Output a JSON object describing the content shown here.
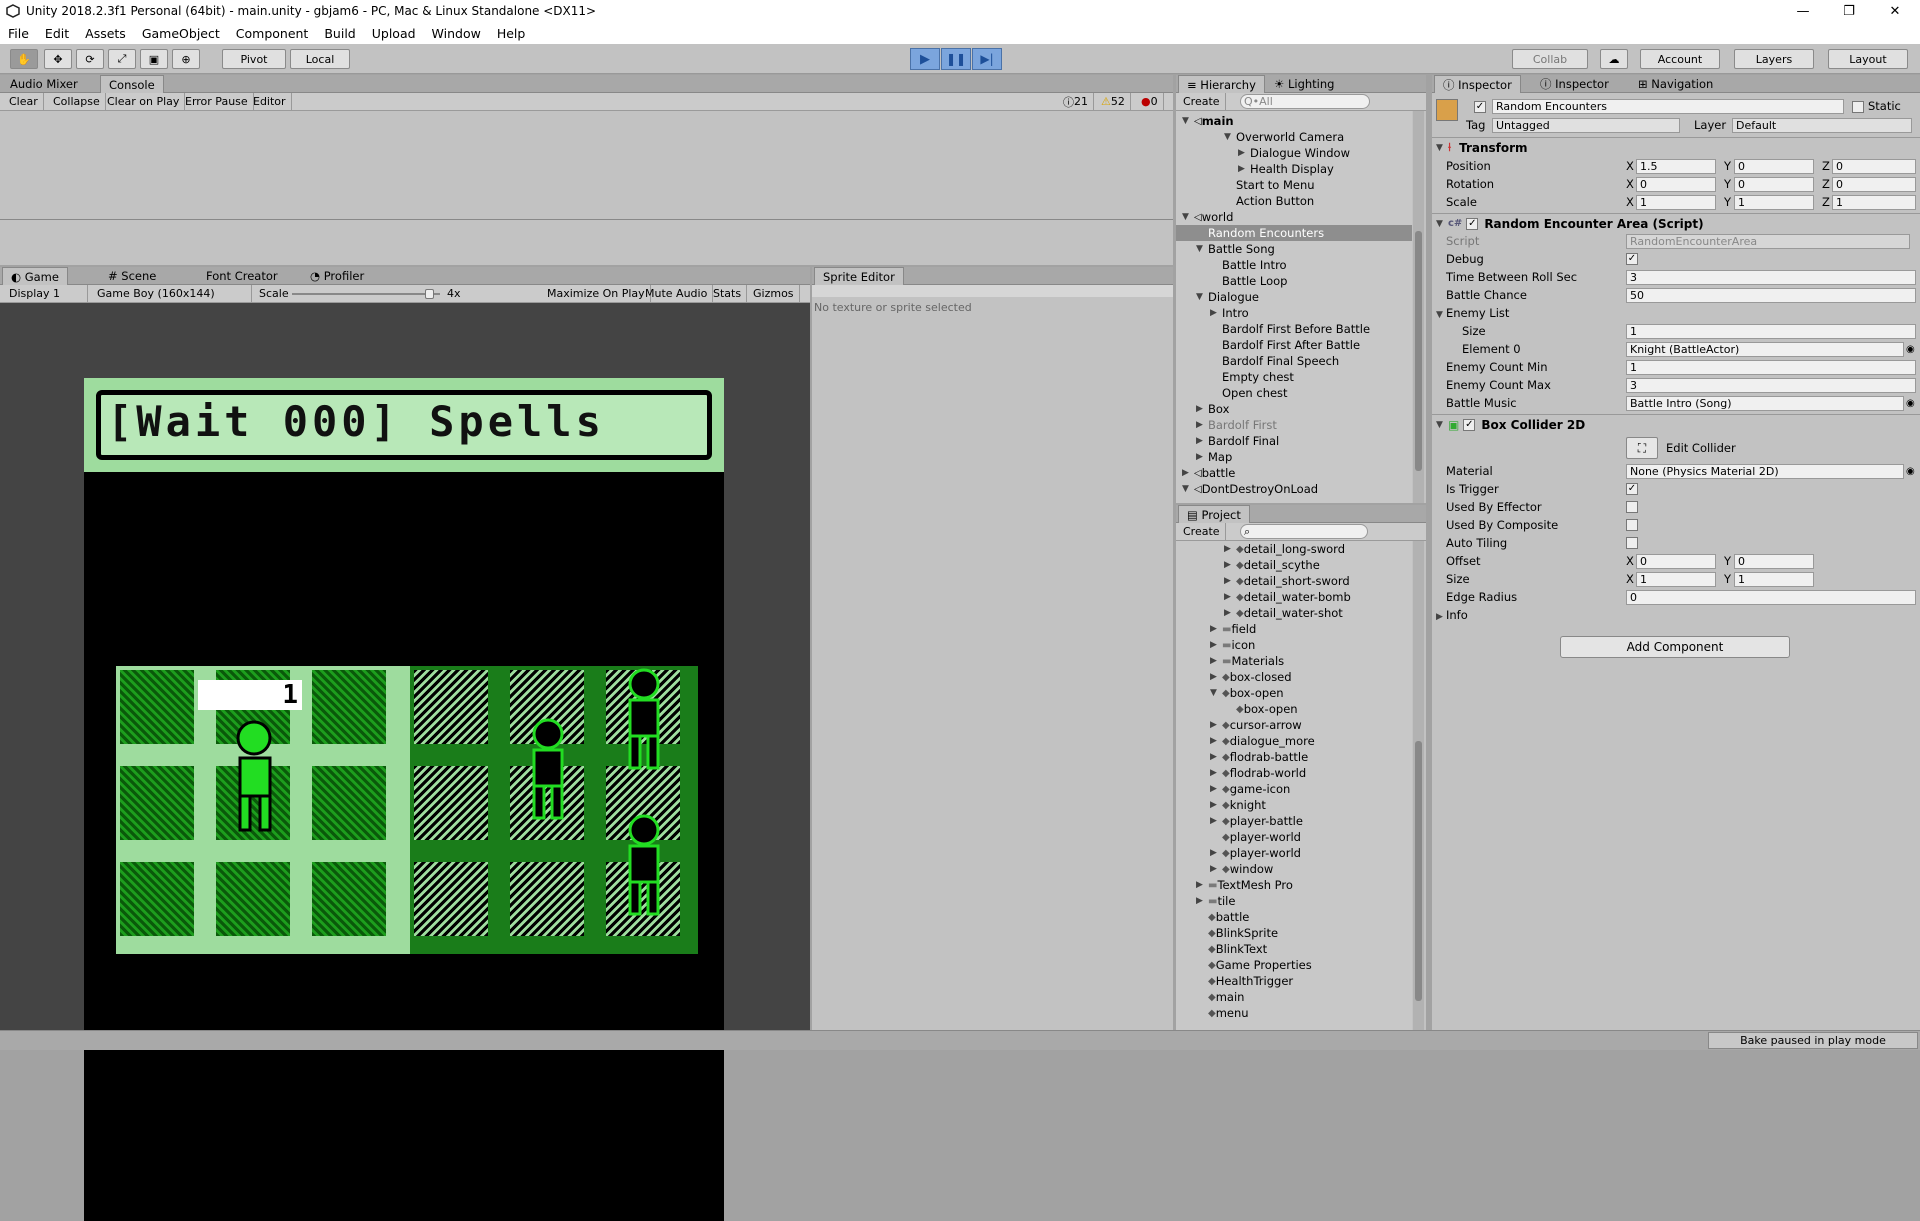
{
  "window": {
    "title": "Unity 2018.2.3f1 Personal (64bit) - main.unity - gbjam6 - PC, Mac & Linux Standalone <DX11>"
  },
  "menu": [
    "File",
    "Edit",
    "Assets",
    "GameObject",
    "Component",
    "Build",
    "Upload",
    "Window",
    "Help"
  ],
  "toolbar": {
    "pivot": "Pivot",
    "local": "Local",
    "collab": "Collab",
    "account": "Account",
    "layers": "Layers",
    "layout": "Layout"
  },
  "console": {
    "tabs": [
      "Audio Mixer",
      "Console"
    ],
    "buttons": [
      "Clear",
      "Collapse",
      "Clear on Play",
      "Error Pause",
      "Editor"
    ],
    "counts": {
      "info": "21",
      "warn": "52",
      "error": "0"
    }
  },
  "game": {
    "tabs": [
      "Game",
      "Scene",
      "Font Creator",
      "Profiler"
    ],
    "display": "Display 1",
    "resolution": "Game Boy (160x144)",
    "scale_label": "Scale",
    "scale_value": "4x",
    "scale_fraction": 0.95,
    "buttons": [
      "Maximize On Play",
      "Mute Audio",
      "Stats",
      "Gizmos"
    ],
    "banner": "[Wait 000] Spells",
    "counter": "1"
  },
  "sprite_editor": {
    "tab": "Sprite Editor",
    "message": "No texture or sprite selected"
  },
  "hierarchy": {
    "tabs": [
      "Hierarchy",
      "Lighting"
    ],
    "create": "Create",
    "search_placeholder": "Q•All",
    "rows": [
      {
        "label": "main",
        "indent": 0,
        "tri": "down",
        "bold": true
      },
      {
        "label": "Overworld Camera",
        "indent": 3,
        "tri": "down"
      },
      {
        "label": "Dialogue Window",
        "indent": 4,
        "tri": "right"
      },
      {
        "label": "Health Display",
        "indent": 4,
        "tri": "right"
      },
      {
        "label": "Start to Menu",
        "indent": 3,
        "tri": ""
      },
      {
        "label": "Action Button",
        "indent": 3,
        "tri": ""
      },
      {
        "label": "world",
        "indent": 0,
        "tri": "down"
      },
      {
        "label": "Random Encounters",
        "indent": 1,
        "tri": "",
        "selected": true
      },
      {
        "label": "Battle Song",
        "indent": 1,
        "tri": "down"
      },
      {
        "label": "Battle Intro",
        "indent": 2,
        "tri": ""
      },
      {
        "label": "Battle Loop",
        "indent": 2,
        "tri": ""
      },
      {
        "label": "Dialogue",
        "indent": 1,
        "tri": "down"
      },
      {
        "label": "Intro",
        "indent": 2,
        "tri": "right"
      },
      {
        "label": "Bardolf First Before Battle",
        "indent": 2,
        "tri": ""
      },
      {
        "label": "Bardolf First After Battle",
        "indent": 2,
        "tri": ""
      },
      {
        "label": "Bardolf Final Speech",
        "indent": 2,
        "tri": ""
      },
      {
        "label": "Empty chest",
        "indent": 2,
        "tri": ""
      },
      {
        "label": "Open chest",
        "indent": 2,
        "tri": ""
      },
      {
        "label": "Box",
        "indent": 1,
        "tri": "right"
      },
      {
        "label": "Bardolf First",
        "indent": 1,
        "tri": "right",
        "grey": true
      },
      {
        "label": "Bardolf Final",
        "indent": 1,
        "tri": "right"
      },
      {
        "label": "Map",
        "indent": 1,
        "tri": "right"
      },
      {
        "label": "battle",
        "indent": 0,
        "tri": "right"
      },
      {
        "label": "DontDestroyOnLoad",
        "indent": 0,
        "tri": "down"
      }
    ]
  },
  "project": {
    "tab": "Project",
    "create": "Create",
    "rows": [
      {
        "label": "detail_long-sword",
        "indent": 3,
        "tri": "right"
      },
      {
        "label": "detail_scythe",
        "indent": 3,
        "tri": "right"
      },
      {
        "label": "detail_short-sword",
        "indent": 3,
        "tri": "right"
      },
      {
        "label": "detail_water-bomb",
        "indent": 3,
        "tri": "right"
      },
      {
        "label": "detail_water-shot",
        "indent": 3,
        "tri": "right"
      },
      {
        "label": "field",
        "indent": 2,
        "tri": "right",
        "folder": true
      },
      {
        "label": "icon",
        "indent": 2,
        "tri": "right",
        "folder": true
      },
      {
        "label": "Materials",
        "indent": 2,
        "tri": "right",
        "folder": true
      },
      {
        "label": "box-closed",
        "indent": 2,
        "tri": "right"
      },
      {
        "label": "box-open",
        "indent": 2,
        "tri": "down"
      },
      {
        "label": "box-open",
        "indent": 3,
        "tri": ""
      },
      {
        "label": "cursor-arrow",
        "indent": 2,
        "tri": "right"
      },
      {
        "label": "dialogue_more",
        "indent": 2,
        "tri": "right"
      },
      {
        "label": "flodrab-battle",
        "indent": 2,
        "tri": "right"
      },
      {
        "label": "flodrab-world",
        "indent": 2,
        "tri": "right"
      },
      {
        "label": "game-icon",
        "indent": 2,
        "tri": "right"
      },
      {
        "label": "knight",
        "indent": 2,
        "tri": "right"
      },
      {
        "label": "player-battle",
        "indent": 2,
        "tri": "right"
      },
      {
        "label": "player-world",
        "indent": 2,
        "tri": ""
      },
      {
        "label": "player-world",
        "indent": 2,
        "tri": "right"
      },
      {
        "label": "window",
        "indent": 2,
        "tri": "right"
      },
      {
        "label": "TextMesh Pro",
        "indent": 1,
        "tri": "right",
        "folder": true
      },
      {
        "label": "tile",
        "indent": 1,
        "tri": "right",
        "folder": true
      },
      {
        "label": "battle",
        "indent": 1,
        "tri": ""
      },
      {
        "label": "BlinkSprite",
        "indent": 1,
        "tri": ""
      },
      {
        "label": "BlinkText",
        "indent": 1,
        "tri": ""
      },
      {
        "label": "Game Properties",
        "indent": 1,
        "tri": ""
      },
      {
        "label": "HealthTrigger",
        "indent": 1,
        "tri": ""
      },
      {
        "label": "main",
        "indent": 1,
        "tri": ""
      },
      {
        "label": "menu",
        "indent": 1,
        "tri": ""
      }
    ]
  },
  "inspector": {
    "tabs": [
      "Inspector",
      "Inspector",
      "Navigation"
    ],
    "object_name": "Random Encounters",
    "static_label": "Static",
    "tag_label": "Tag",
    "tag_value": "Untagged",
    "layer_label": "Layer",
    "layer_value": "Default",
    "transform": {
      "title": "Transform",
      "position": {
        "label": "Position",
        "x": "1.5",
        "y": "0",
        "z": "0"
      },
      "rotation": {
        "label": "Rotation",
        "x": "0",
        "y": "0",
        "z": "0"
      },
      "scale": {
        "label": "Scale",
        "x": "1",
        "y": "1",
        "z": "1"
      }
    },
    "script_component": {
      "title": "Random Encounter Area (Script)",
      "script_label": "Script",
      "script_value": "RandomEncounterArea",
      "debug_label": "Debug",
      "time_label": "Time Between Roll Sec",
      "time_value": "3",
      "chance_label": "Battle Chance",
      "chance_value": "50",
      "enemy_list_label": "Enemy List",
      "size_label": "Size",
      "size_value": "1",
      "element0_label": "Element 0",
      "element0_value": "Knight (BattleActor)",
      "count_min_label": "Enemy Count Min",
      "count_min_value": "1",
      "count_max_label": "Enemy Count Max",
      "count_max_value": "3",
      "music_label": "Battle Music",
      "music_value": "Battle Intro (Song)"
    },
    "collider": {
      "title": "Box Collider 2D",
      "edit_label": "Edit Collider",
      "material_label": "Material",
      "material_value": "None (Physics Material 2D)",
      "trigger_label": "Is Trigger",
      "effector_label": "Used By Effector",
      "composite_label": "Used By Composite",
      "tiling_label": "Auto Tiling",
      "offset_label": "Offset",
      "offset_x": "0",
      "offset_y": "0",
      "size_label": "Size",
      "size_x": "1",
      "size_y": "1",
      "edge_label": "Edge Radius",
      "edge_value": "0",
      "info_label": "Info"
    },
    "add_component": "Add Component"
  },
  "status": {
    "bake": "Bake paused in play mode"
  }
}
